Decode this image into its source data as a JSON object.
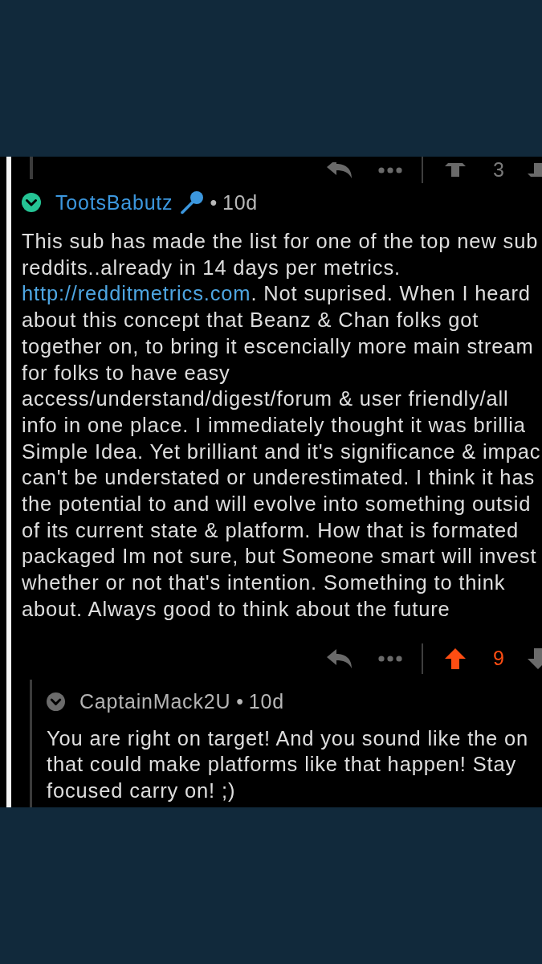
{
  "previous_comment": {
    "actions": {
      "upvoted": false,
      "score": "3"
    }
  },
  "comments": [
    {
      "author": "TootsBabutz",
      "highlighted": true,
      "flair": {
        "kind": "microphone"
      },
      "separator": "•",
      "age": "10d",
      "body": [
        {
          "text": "This sub has made the list for one of the top new sub"
        },
        {
          "text": "reddits..already in 14 days per metrics."
        },
        {
          "link": "http://redditmetrics.com",
          "text": ". Not suprised. When I heard"
        },
        {
          "text": "about this concept that Beanz & Chan folks got"
        },
        {
          "text": "together on, to bring it escencially more main stream"
        },
        {
          "text": "for folks to have easy"
        },
        {
          "text": "access/understand/digest/forum & user friendly/all"
        },
        {
          "text": "info in one place. I immediately thought it was brillia"
        },
        {
          "text": "Simple Idea. Yet brilliant and it's significance & impac"
        },
        {
          "text": "can't be understated or underestimated. I think it has"
        },
        {
          "text": "the potential to and will evolve into something outsid"
        },
        {
          "text": "of its current state & platform. How that is formated"
        },
        {
          "text": "packaged Im not sure, but Someone smart will invest"
        },
        {
          "text": "whether or not that's intention. Something to think"
        },
        {
          "text": "about. Always good to think about the future"
        }
      ],
      "actions": {
        "upvoted": true,
        "score": "9"
      },
      "replies": [
        {
          "author": "CaptainMack2U",
          "highlighted": false,
          "separator": "•",
          "age": "10d",
          "body": [
            {
              "text": "You are right on target! And you sound like the on"
            },
            {
              "text": "that could make platforms like that happen! Stay"
            },
            {
              "text": "focused carry on! ;)"
            }
          ]
        }
      ]
    }
  ]
}
